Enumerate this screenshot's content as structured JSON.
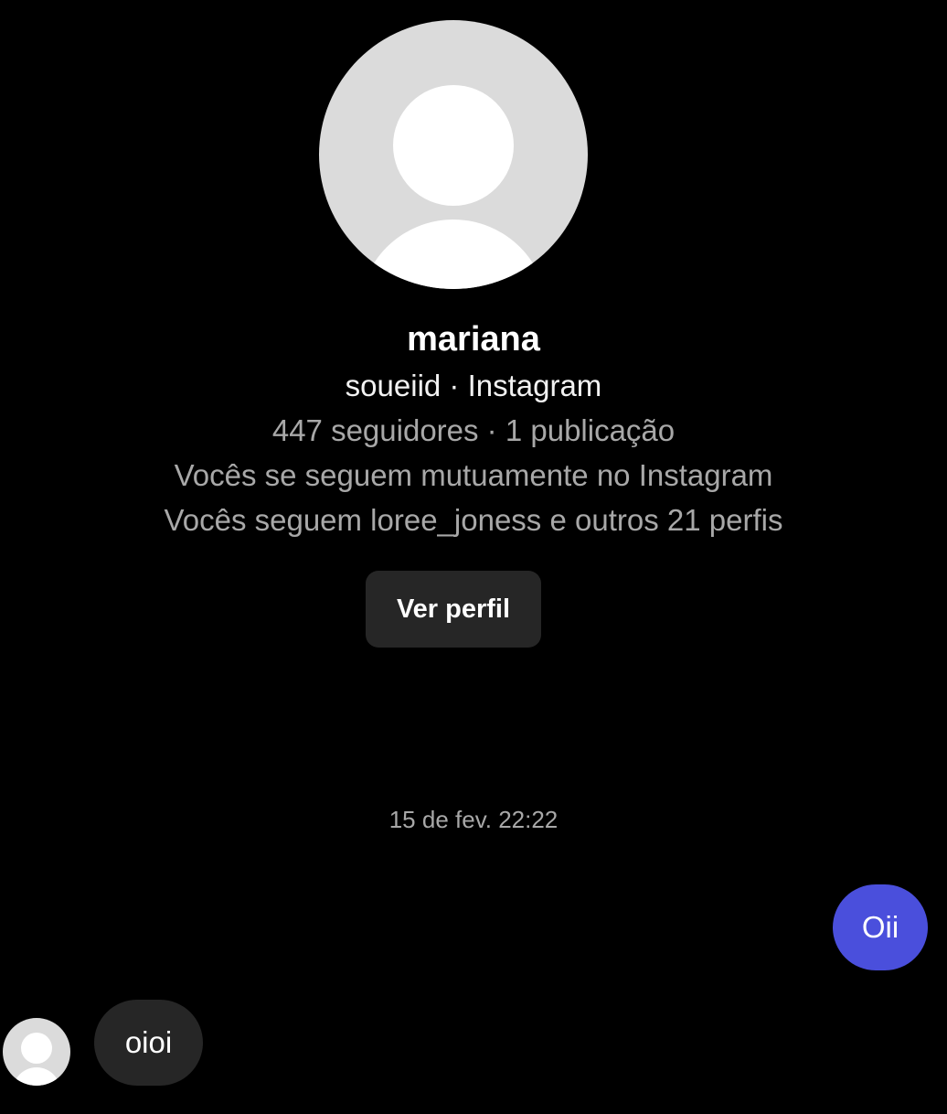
{
  "profile": {
    "name": "mariana",
    "handle_line": "soueiid · Instagram",
    "stats_line": "447 seguidores · 1 publicação",
    "mutual_line": "Vocês se seguem mutuamente no Instagram",
    "follows_line": "Vocês seguem loree_joness e outros 21 perfis",
    "view_profile_label": "Ver perfil",
    "avatar_icon": "default-user-avatar-icon"
  },
  "conversation": {
    "timestamp": "15 de fev. 22:22",
    "messages": [
      {
        "direction": "sent",
        "text": "Oii"
      },
      {
        "direction": "received",
        "text": "oioi"
      }
    ]
  },
  "colors": {
    "background": "#000000",
    "sent_bubble": "#4a4fdc",
    "received_bubble": "#262626",
    "button": "#262626",
    "secondary_text": "#a8a8a8",
    "avatar_placeholder": "#dbdbdb"
  }
}
